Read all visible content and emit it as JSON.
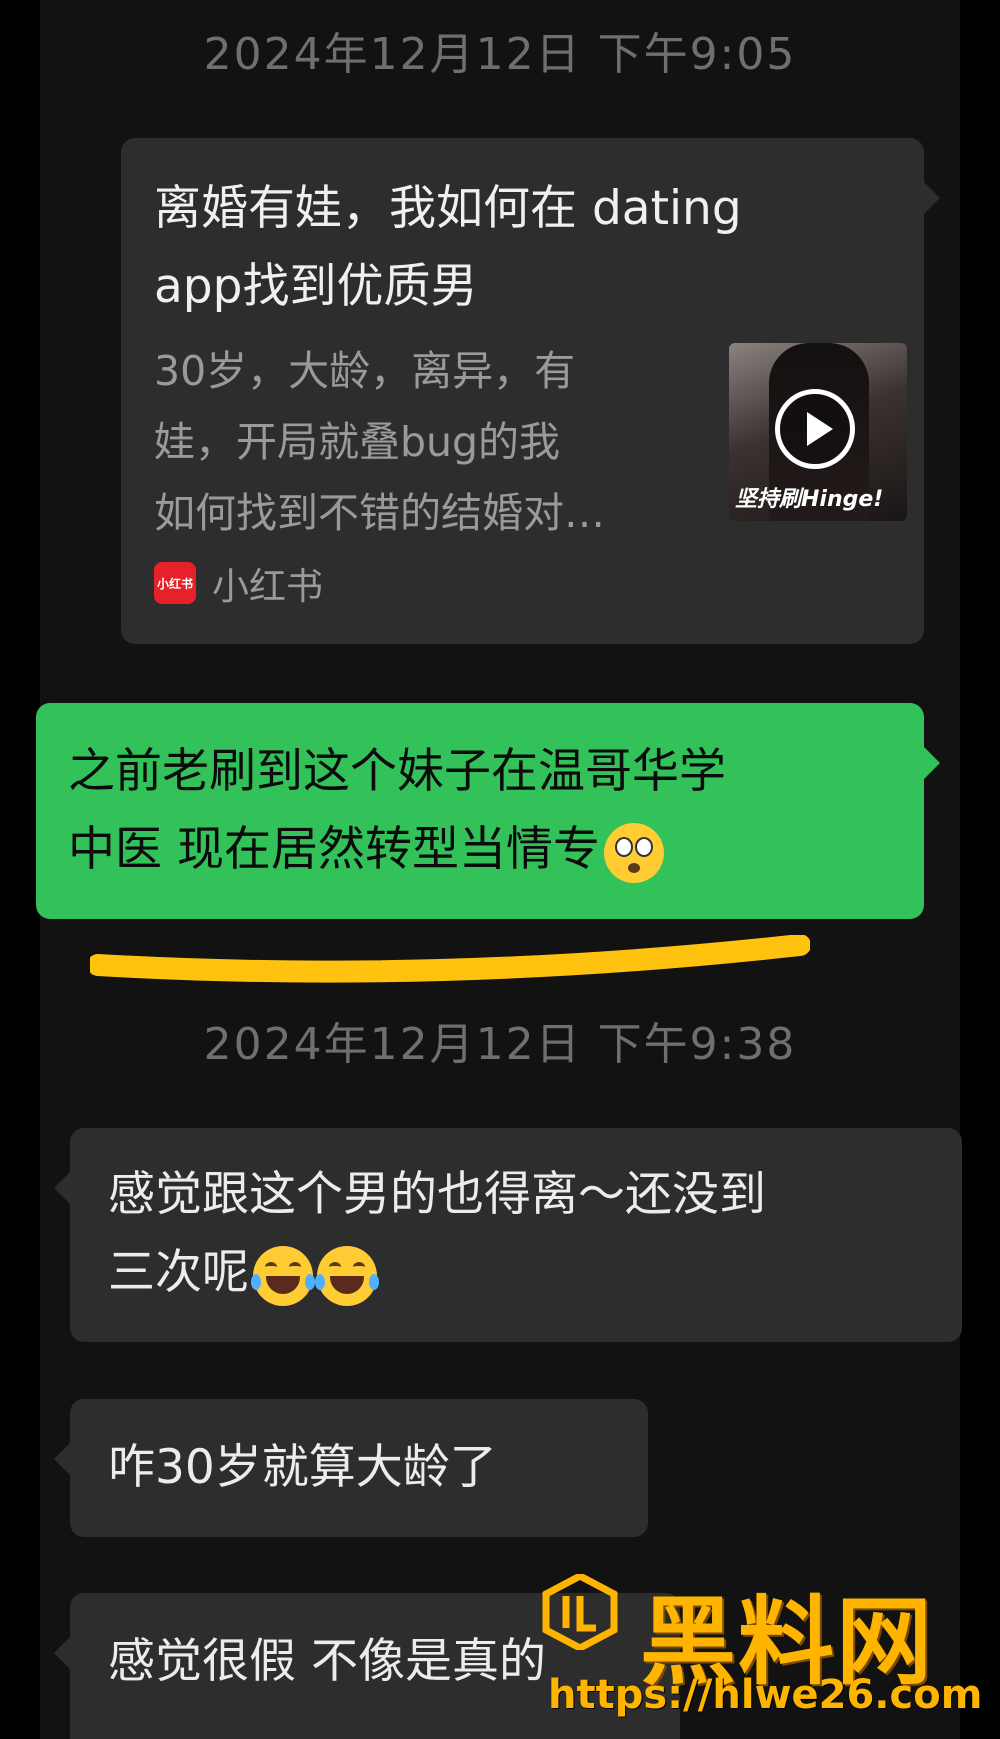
{
  "timestamps": [
    "2024年12月12日 下午9:05",
    "2024年12月12日 下午9:38"
  ],
  "shared_card": {
    "title_line1": "离婚有娃，我如何在 dating",
    "title_line2": "app找到优质男",
    "desc_line1": "30岁，大龄，离异，有",
    "desc_line2": "娃，开局就叠bug的我",
    "desc_line3": "如何找到不错的结婚对…",
    "thumbnail_caption": "坚持刷Hinge!",
    "source_logo_text": "小红书",
    "source_label": "小红书"
  },
  "sent_message": {
    "line1": "之前老刷到这个妹子在温哥华学",
    "line2": "中医 现在居然转型当情专",
    "emoji": "flushed-face"
  },
  "received_messages": [
    {
      "line1": "感觉跟这个男的也得离～还没到",
      "line2": "三次呢",
      "emoji": "face-with-tears-of-joy x2"
    },
    {
      "line1": "咋30岁就算大龄了"
    },
    {
      "line1": "感觉很假 不像是真的"
    }
  ],
  "watermark": {
    "title": "黑料网",
    "url": "https://hlwe26.com"
  },
  "colors": {
    "background": "#121212",
    "bubble_dark": "#2d2d2d",
    "bubble_green": "#33c15a",
    "highlight_underline": "#ffc20e",
    "watermark": "#ffb400"
  }
}
